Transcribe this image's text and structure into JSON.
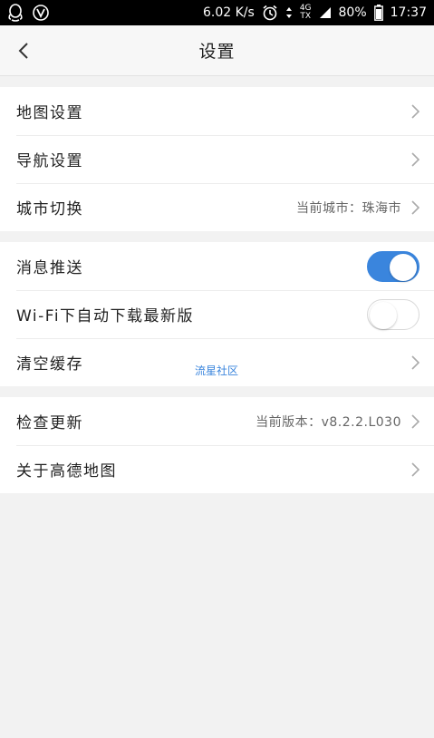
{
  "statusbar": {
    "speed": "6.02 K/s",
    "net_top": "4G",
    "net_bottom": "TX",
    "battery": "80%",
    "time": "17:37"
  },
  "navbar": {
    "title": "设置"
  },
  "groups": [
    {
      "items": [
        {
          "label": "地图设置",
          "value": ""
        },
        {
          "label": "导航设置",
          "value": ""
        },
        {
          "label": "城市切换",
          "value": "当前城市：珠海市"
        }
      ]
    },
    {
      "items": [
        {
          "label": "消息推送",
          "toggle": true
        },
        {
          "label": "Wi-Fi下自动下载最新版",
          "toggle": false
        },
        {
          "label": "清空缓存",
          "value": ""
        }
      ]
    },
    {
      "items": [
        {
          "label": "检查更新",
          "value": "当前版本：v8.2.2.L030"
        },
        {
          "label": "关于高德地图",
          "value": ""
        }
      ]
    }
  ],
  "watermark": "流星社区",
  "colors": {
    "accent": "#3a85dd",
    "background": "#f2f2f2"
  }
}
